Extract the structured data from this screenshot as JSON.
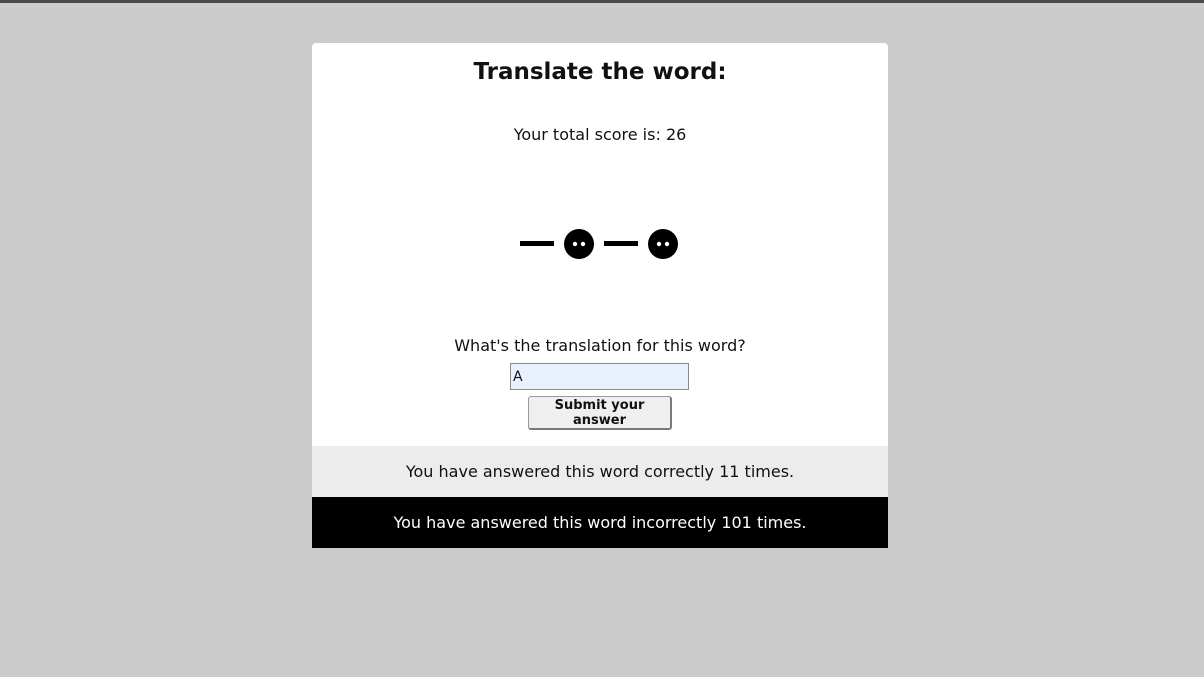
{
  "quiz": {
    "title": "Translate the word:",
    "score_label": "Your total score is: 26",
    "morse_word": {
      "symbols": [
        "dash",
        "dot-pair",
        "dash",
        "dot-pair"
      ],
      "color": "#000000"
    },
    "question": "What's the translation for this word?",
    "answer_value": "A",
    "submit_label": "Submit your answer",
    "correct_message": "You have answered this word correctly 11 times.",
    "incorrect_message": "You have answered this word incorrectly 101 times."
  },
  "colors": {
    "page_background": "#cccccc",
    "card_background": "#ffffff",
    "correct_bar": "#ececec",
    "incorrect_bar": "#000000",
    "input_background": "#e8f0fe"
  }
}
